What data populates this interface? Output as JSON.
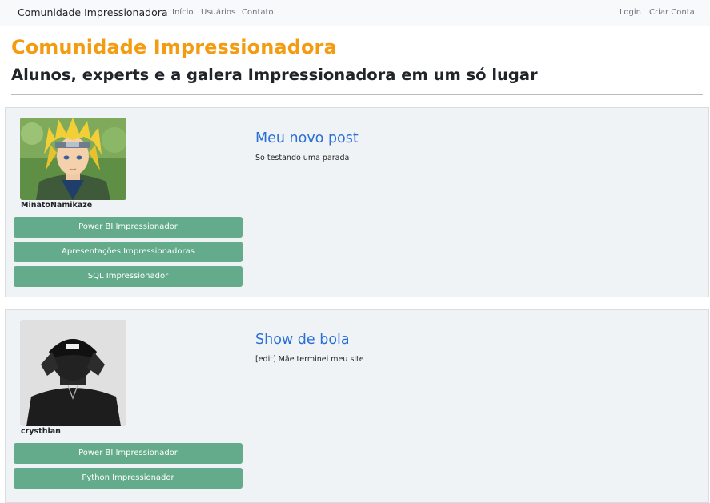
{
  "navbar": {
    "brand": "Comunidade Impressionadora",
    "links": {
      "home": "Início",
      "users": "Usuários",
      "contact": "Contato"
    },
    "right": {
      "login": "Login",
      "register": "Criar Conta"
    }
  },
  "header": {
    "title": "Comunidade Impressionadora",
    "subtitle": "Alunos, experts e a galera Impressionadora em um só lugar"
  },
  "posts": [
    {
      "username": "MinatoNamikaze",
      "avatar_icon": "anime-character-avatar",
      "courses": [
        "Power BI Impressionador",
        "Apresentações Impressionadoras",
        "SQL Impressionador"
      ],
      "title": "Meu novo post",
      "body": "So testando uma parada"
    },
    {
      "username": "crysthian",
      "avatar_icon": "person-photo-avatar",
      "courses": [
        "Power BI Impressionador",
        "Python Impressionador"
      ],
      "title": "Show de bola",
      "body": "[edit] Mãe terminei meu site"
    }
  ],
  "colors": {
    "accent_title": "#f39c12",
    "link_blue": "#2a6fd6",
    "course_button": "#63ab8a",
    "card_bg": "#f0f3f6",
    "navbar_bg": "#f8f9fa"
  }
}
